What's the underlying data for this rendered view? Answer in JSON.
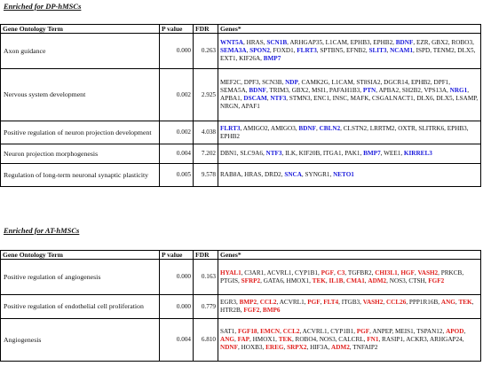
{
  "sections": [
    {
      "title": "Enriched for DP-hMSCs",
      "headers": [
        "Gene Ontology Term",
        "P value",
        "FDR",
        "Genes*"
      ],
      "rows": [
        {
          "term": "Axon guidance",
          "p": "0.000",
          "fdr": "0.263",
          "genes": [
            {
              "g": "WNT5A",
              "c": "b"
            },
            {
              "g": "HRAS",
              "c": "k"
            },
            {
              "g": "SCN1B",
              "c": "b"
            },
            {
              "g": "ARHGAP35",
              "c": "k"
            },
            {
              "g": "L1CAM",
              "c": "k"
            },
            {
              "g": "EPHB3",
              "c": "k"
            },
            {
              "g": "EPHB2",
              "c": "k"
            },
            {
              "g": "BDNF",
              "c": "b"
            },
            {
              "g": "EZR",
              "c": "k"
            },
            {
              "g": "GBX2",
              "c": "k"
            },
            {
              "g": "ROBO3",
              "c": "k"
            },
            {
              "g": "SEMA3A",
              "c": "b"
            },
            {
              "g": "SPON2",
              "c": "b"
            },
            {
              "g": "FOXD1",
              "c": "k"
            },
            {
              "g": "FLRT3",
              "c": "b"
            },
            {
              "g": "SPTBN5",
              "c": "k"
            },
            {
              "g": "EFNB2",
              "c": "k"
            },
            {
              "g": "SLIT3",
              "c": "b"
            },
            {
              "g": "NCAM1",
              "c": "b"
            },
            {
              "g": "ISPD",
              "c": "k"
            },
            {
              "g": "TENM2",
              "c": "k"
            },
            {
              "g": "DLX5",
              "c": "k"
            },
            {
              "g": "EXT1",
              "c": "k"
            },
            {
              "g": "KIF26A",
              "c": "k"
            },
            {
              "g": "BMP7",
              "c": "b"
            }
          ]
        },
        {
          "term": "Nervous system development",
          "p": "0.002",
          "fdr": "2.925",
          "genes": [
            {
              "g": "MEF2C",
              "c": "k"
            },
            {
              "g": "DPF3",
              "c": "k"
            },
            {
              "g": "SCN3B",
              "c": "k"
            },
            {
              "g": "NDP",
              "c": "b"
            },
            {
              "g": "CAMK2G",
              "c": "k"
            },
            {
              "g": "L1CAM",
              "c": "k"
            },
            {
              "g": "ST8SIA2",
              "c": "k"
            },
            {
              "g": "DGCR14",
              "c": "k"
            },
            {
              "g": "EPHB2",
              "c": "k"
            },
            {
              "g": "DPF1",
              "c": "k"
            },
            {
              "g": "SEMA5A",
              "c": "k"
            },
            {
              "g": "BDNF",
              "c": "b"
            },
            {
              "g": "TRIM3",
              "c": "k"
            },
            {
              "g": "GBX2",
              "c": "k"
            },
            {
              "g": "MSI1",
              "c": "k"
            },
            {
              "g": "PAFAH1B3",
              "c": "k"
            },
            {
              "g": "PTN",
              "c": "b"
            },
            {
              "g": "APBA2",
              "c": "k"
            },
            {
              "g": "SH2B2",
              "c": "k"
            },
            {
              "g": "VPS13A",
              "c": "k"
            },
            {
              "g": "NRG1",
              "c": "b"
            },
            {
              "g": "APBA1",
              "c": "k"
            },
            {
              "g": "DSCAM",
              "c": "b"
            },
            {
              "g": "NTF3",
              "c": "b"
            },
            {
              "g": "STMN3",
              "c": "k"
            },
            {
              "g": "ENC1",
              "c": "k"
            },
            {
              "g": "INSC",
              "c": "k"
            },
            {
              "g": "MAFK",
              "c": "k"
            },
            {
              "g": "CSGALNACT1",
              "c": "k"
            },
            {
              "g": "DLX6",
              "c": "k"
            },
            {
              "g": "DLX5",
              "c": "k"
            },
            {
              "g": "LSAMP",
              "c": "k"
            },
            {
              "g": "NRGN",
              "c": "k"
            },
            {
              "g": "APAF1",
              "c": "k"
            }
          ]
        },
        {
          "term": "Positive regulation of neuron projection development",
          "p": "0.002",
          "fdr": "4.038",
          "genes": [
            {
              "g": "FLRT3",
              "c": "b"
            },
            {
              "g": "AMIGO2",
              "c": "k"
            },
            {
              "g": "AMIGO3",
              "c": "k"
            },
            {
              "g": "BDNF",
              "c": "b"
            },
            {
              "g": "CBLN2",
              "c": "b"
            },
            {
              "g": "CLSTN2",
              "c": "k"
            },
            {
              "g": "LRRTM2",
              "c": "k"
            },
            {
              "g": "OXTR",
              "c": "k"
            },
            {
              "g": "SLITRK6",
              "c": "k"
            },
            {
              "g": "EPHB3",
              "c": "k"
            },
            {
              "g": "EPHB2",
              "c": "k"
            }
          ]
        },
        {
          "term": "Neuron projection morphogenesis",
          "p": "0.004",
          "fdr": "7.202",
          "genes": [
            {
              "g": "DBN1",
              "c": "k"
            },
            {
              "g": "SLC9A6",
              "c": "k"
            },
            {
              "g": "NTF3",
              "c": "b"
            },
            {
              "g": "ILK",
              "c": "k"
            },
            {
              "g": "KIF20B",
              "c": "k"
            },
            {
              "g": "ITGA1",
              "c": "k"
            },
            {
              "g": "PAK1",
              "c": "k"
            },
            {
              "g": "BMP7",
              "c": "b"
            },
            {
              "g": "WEE1",
              "c": "k"
            },
            {
              "g": "KIRREL3",
              "c": "b"
            }
          ]
        },
        {
          "term": "Regulation of long-term neuronal synaptic plasticity",
          "p": "0.005",
          "fdr": "9.578",
          "genes": [
            {
              "g": "RAB8A",
              "c": "k"
            },
            {
              "g": "HRAS",
              "c": "k"
            },
            {
              "g": "DRD2",
              "c": "k"
            },
            {
              "g": "SNCA",
              "c": "b"
            },
            {
              "g": "SYNGR1",
              "c": "k"
            },
            {
              "g": "NETO1",
              "c": "b"
            }
          ]
        }
      ]
    },
    {
      "title": "Enriched for AT-hMSCs",
      "headers": [
        "Gene Ontology Term",
        "P value",
        "FDR",
        "Genes*"
      ],
      "rows": [
        {
          "term": "Positive regulation of angiogenesis",
          "p": "0.000",
          "fdr": "0.163",
          "genes": [
            {
              "g": "HYAL1",
              "c": "r"
            },
            {
              "g": "C3AR1",
              "c": "k"
            },
            {
              "g": "ACVRL1",
              "c": "k"
            },
            {
              "g": "CYP1B1",
              "c": "k"
            },
            {
              "g": "PGF",
              "c": "r"
            },
            {
              "g": "C3",
              "c": "r"
            },
            {
              "g": "TGFBR2",
              "c": "k"
            },
            {
              "g": "CHI3L1",
              "c": "r"
            },
            {
              "g": "HGF",
              "c": "r"
            },
            {
              "g": "VASH2",
              "c": "r"
            },
            {
              "g": "PRKCB",
              "c": "k"
            },
            {
              "g": "PTGIS",
              "c": "k"
            },
            {
              "g": "SFRP2",
              "c": "r"
            },
            {
              "g": "GATA6",
              "c": "k"
            },
            {
              "g": "HMOX1",
              "c": "k"
            },
            {
              "g": "TEK",
              "c": "r"
            },
            {
              "g": "IL1B",
              "c": "r"
            },
            {
              "g": "CMA1",
              "c": "r"
            },
            {
              "g": "ADM2",
              "c": "r"
            },
            {
              "g": "NOS3",
              "c": "k"
            },
            {
              "g": "CTSH",
              "c": "k"
            },
            {
              "g": "FGF2",
              "c": "r"
            }
          ]
        },
        {
          "term": "Positive regulation of endothelial cell proliferation",
          "p": "0.000",
          "fdr": "0.779",
          "genes": [
            {
              "g": "EGR3",
              "c": "k"
            },
            {
              "g": "BMP2",
              "c": "r"
            },
            {
              "g": "CCL2",
              "c": "r"
            },
            {
              "g": "ACVRL1",
              "c": "k"
            },
            {
              "g": "PGF",
              "c": "r"
            },
            {
              "g": "FLT4",
              "c": "r"
            },
            {
              "g": "ITGB3",
              "c": "k"
            },
            {
              "g": "VASH2",
              "c": "r"
            },
            {
              "g": "CCL26",
              "c": "r"
            },
            {
              "g": "PPP1R16B",
              "c": "k"
            },
            {
              "g": "ANG",
              "c": "r"
            },
            {
              "g": "TEK",
              "c": "r"
            },
            {
              "g": "HTR2B",
              "c": "k"
            },
            {
              "g": "FGF2",
              "c": "r"
            },
            {
              "g": "BMP6",
              "c": "r"
            }
          ]
        },
        {
          "term": "Angiogenesis",
          "p": "0.004",
          "fdr": "6.810",
          "genes": [
            {
              "g": "SAT1",
              "c": "k"
            },
            {
              "g": "FGF18",
              "c": "r"
            },
            {
              "g": "EMCN",
              "c": "r"
            },
            {
              "g": "CCL2",
              "c": "r"
            },
            {
              "g": "ACVRL1",
              "c": "k"
            },
            {
              "g": "CYP1B1",
              "c": "k"
            },
            {
              "g": "PGF",
              "c": "r"
            },
            {
              "g": "ANPEP",
              "c": "k"
            },
            {
              "g": "MEIS1",
              "c": "k"
            },
            {
              "g": "TSPAN12",
              "c": "k"
            },
            {
              "g": "APOD",
              "c": "r"
            },
            {
              "g": "ANG",
              "c": "r"
            },
            {
              "g": "FAP",
              "c": "r"
            },
            {
              "g": "HMOX1",
              "c": "k"
            },
            {
              "g": "TEK",
              "c": "r"
            },
            {
              "g": "ROBO4",
              "c": "k"
            },
            {
              "g": "NOS3",
              "c": "k"
            },
            {
              "g": "CALCRL",
              "c": "k"
            },
            {
              "g": "FN1",
              "c": "r"
            },
            {
              "g": "RASIP1",
              "c": "k"
            },
            {
              "g": "ACKR3",
              "c": "k"
            },
            {
              "g": "ARHGAP24",
              "c": "k"
            },
            {
              "g": "NDNF",
              "c": "r"
            },
            {
              "g": "HOXB3",
              "c": "k"
            },
            {
              "g": "EREG",
              "c": "r"
            },
            {
              "g": "SRPX2",
              "c": "r"
            },
            {
              "g": "HIF3A",
              "c": "k"
            },
            {
              "g": "ADM2",
              "c": "r"
            },
            {
              "g": "TNFAIP2",
              "c": "k"
            }
          ]
        }
      ]
    }
  ]
}
